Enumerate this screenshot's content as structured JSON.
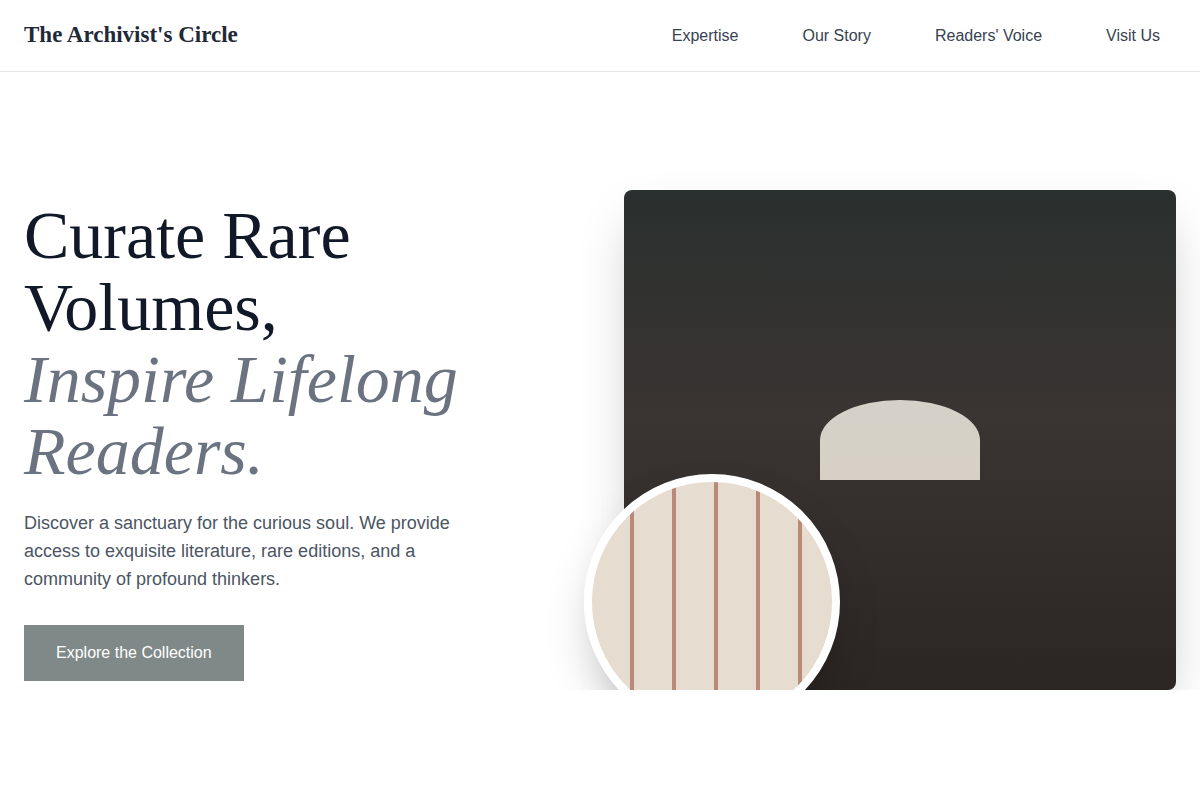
{
  "header": {
    "logo": "The Archivist's Circle",
    "nav": [
      "Expertise",
      "Our Story",
      "Readers' Voice",
      "Visit Us"
    ]
  },
  "hero": {
    "heading_plain": "Curate Rare Volumes,",
    "heading_italic": "Inspire Lifelong Readers.",
    "description": "Discover a sanctuary for the curious soul. We provide access to exquisite literature, rare editions, and a community of profound thinkers.",
    "button": "Explore the Collection"
  }
}
